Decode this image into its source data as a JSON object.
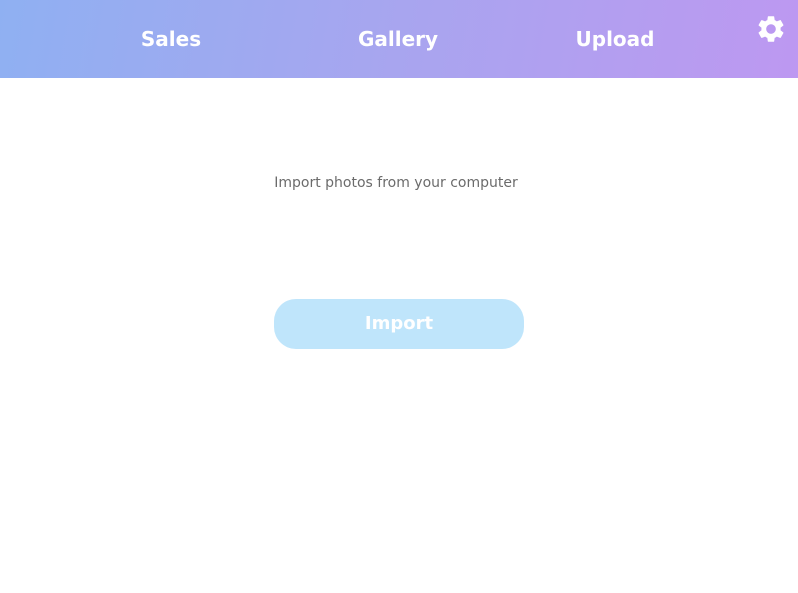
{
  "nav": {
    "items": [
      {
        "label": "Sales"
      },
      {
        "label": "Gallery"
      },
      {
        "label": "Upload"
      }
    ],
    "settings_icon": "gear-icon"
  },
  "main": {
    "description": "Import photos from your computer",
    "import_button_label": "Import"
  },
  "colors": {
    "header_gradient_start": "#8fb0f2",
    "header_gradient_end": "#bd98f1",
    "import_button_bg": "#bfe5fb",
    "description_text": "#6b6b6b"
  }
}
